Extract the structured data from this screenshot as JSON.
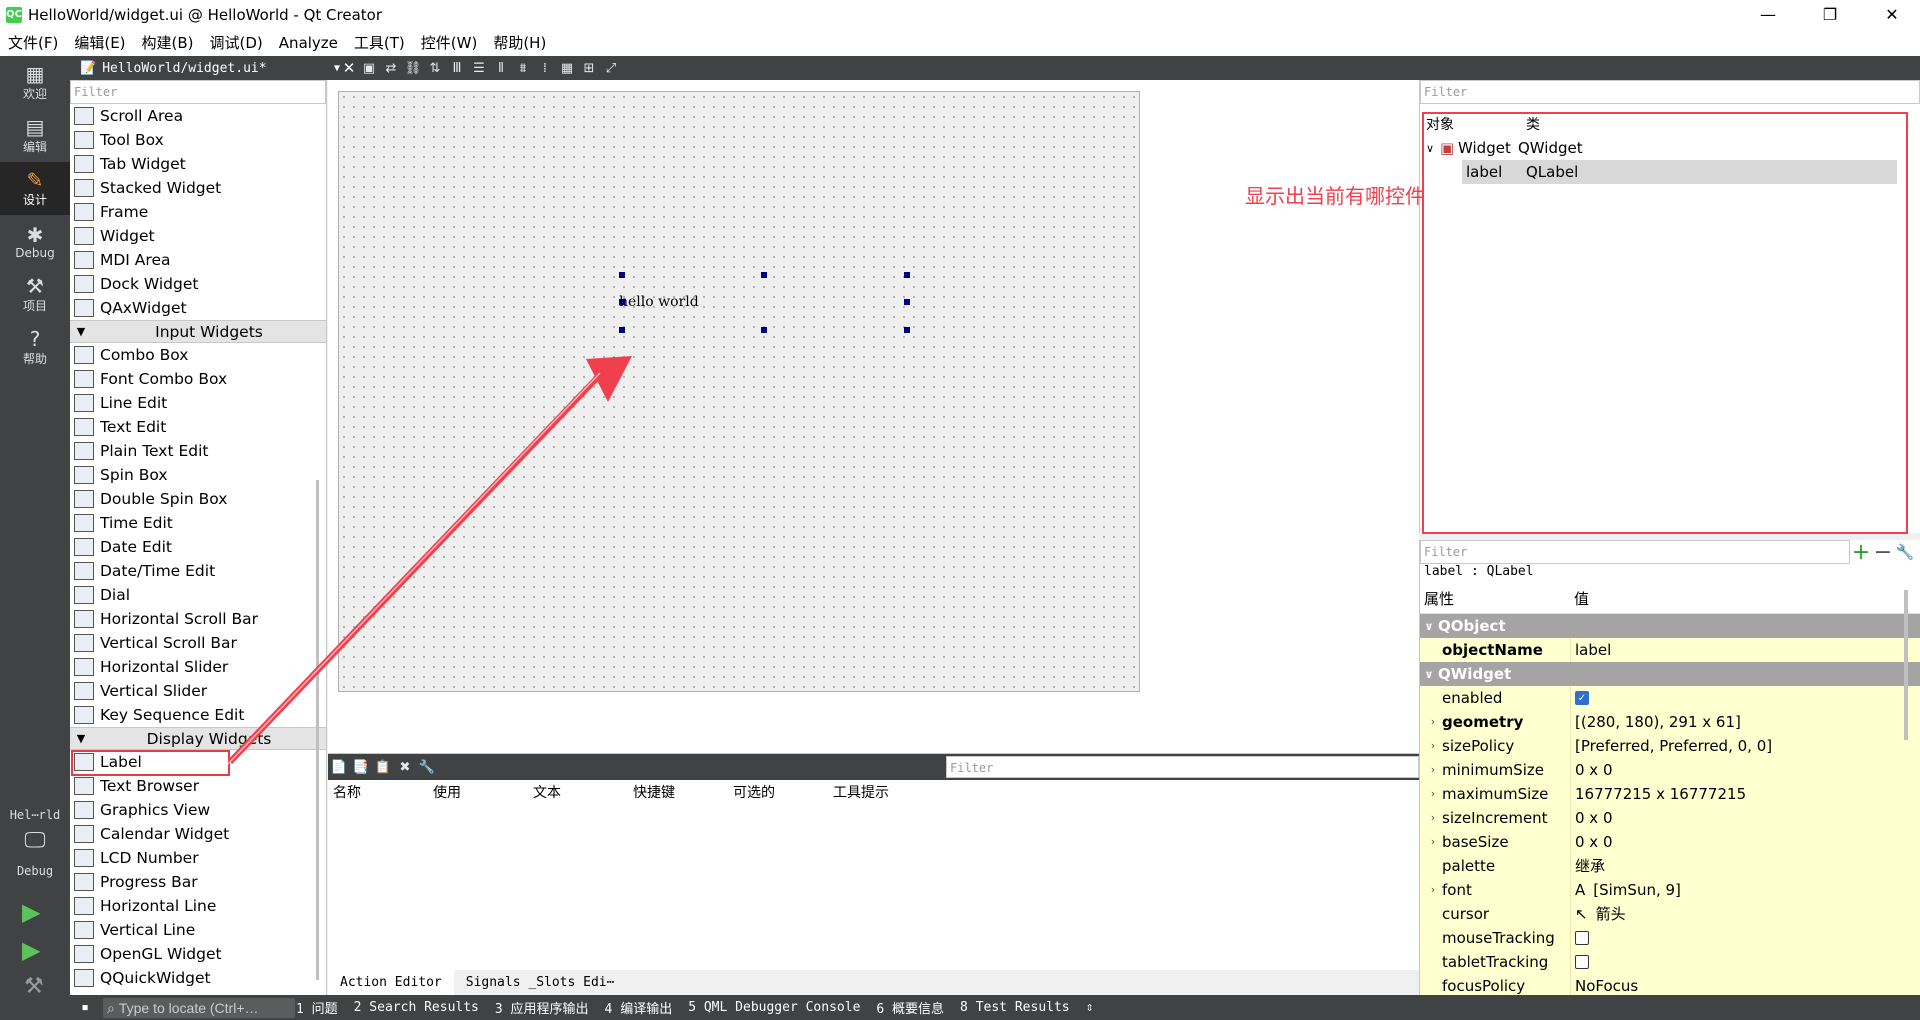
{
  "window": {
    "title": "HelloWorld/widget.ui @ HelloWorld - Qt Creator",
    "logo": "QC"
  },
  "menubar": [
    "文件(F)",
    "编辑(E)",
    "构建(B)",
    "调试(D)",
    "Analyze",
    "工具(T)",
    "控件(W)",
    "帮助(H)"
  ],
  "modes": [
    {
      "label": "欢迎",
      "icon": "grid-icon"
    },
    {
      "label": "编辑",
      "icon": "edit-icon"
    },
    {
      "label": "设计",
      "icon": "pencil-icon"
    },
    {
      "label": "Debug",
      "icon": "bug-icon"
    },
    {
      "label": "项目",
      "icon": "wrench-icon"
    },
    {
      "label": "帮助",
      "icon": "help-icon"
    }
  ],
  "kit": {
    "project": "Hel⋯rld",
    "config": "Debug"
  },
  "editor_tab": {
    "file": "HelloWorld/widget.ui*"
  },
  "widgetbox": {
    "filter_placeholder": "Filter",
    "containers": [
      "Scroll Area",
      "Tool Box",
      "Tab Widget",
      "Stacked Widget",
      "Frame",
      "Widget",
      "MDI Area",
      "Dock Widget",
      "QAxWidget"
    ],
    "input_title": "Input Widgets",
    "input": [
      "Combo Box",
      "Font Combo Box",
      "Line Edit",
      "Text Edit",
      "Plain Text Edit",
      "Spin Box",
      "Double Spin Box",
      "Time Edit",
      "Date Edit",
      "Date/Time Edit",
      "Dial",
      "Horizontal Scroll Bar",
      "Vertical Scroll Bar",
      "Horizontal Slider",
      "Vertical Slider",
      "Key Sequence Edit"
    ],
    "display_title": "Display Widgets",
    "display": [
      "Label",
      "Text Browser",
      "Graphics View",
      "Calendar Widget",
      "LCD Number",
      "Progress Bar",
      "Horizontal Line",
      "Vertical Line",
      "OpenGL Widget",
      "QQuickWidget"
    ]
  },
  "form": {
    "label_text": "hello world"
  },
  "action_editor": {
    "filter_placeholder": "Filter",
    "columns": [
      "名称",
      "使用",
      "文本",
      "快捷键",
      "可选的",
      "工具提示"
    ],
    "tabs": [
      "Action Editor",
      "Signals _Slots Edi⋯"
    ]
  },
  "object_inspector": {
    "filter_placeholder": "Filter",
    "col_object": "对象",
    "col_class": "类",
    "rows": [
      {
        "object": "Widget",
        "class": "QWidget"
      },
      {
        "object": "label",
        "class": "QLabel"
      }
    ],
    "annotation": "显示出当前有哪控件"
  },
  "property_editor": {
    "filter_placeholder": "Filter",
    "class_line": "label : QLabel",
    "col_property": "属性",
    "col_value": "值",
    "section_qobject": "QObject",
    "objectName": {
      "name": "objectName",
      "value": "label"
    },
    "section_qwidget": "QWidget",
    "rows": [
      {
        "name": "enabled",
        "value": "",
        "expand": false,
        "bold": false,
        "check": "on"
      },
      {
        "name": "geometry",
        "value": "[(280, 180), 291 x 61]",
        "expand": true,
        "bold": true
      },
      {
        "name": "sizePolicy",
        "value": "[Preferred, Preferred, 0, 0]",
        "expand": true,
        "bold": false
      },
      {
        "name": "minimumSize",
        "value": "0 x 0",
        "expand": true,
        "bold": false
      },
      {
        "name": "maximumSize",
        "value": "16777215 x 16777215",
        "expand": true,
        "bold": false
      },
      {
        "name": "sizeIncrement",
        "value": "0 x 0",
        "expand": true,
        "bold": false
      },
      {
        "name": "baseSize",
        "value": "0 x 0",
        "expand": true,
        "bold": false
      },
      {
        "name": "palette",
        "value": "继承",
        "expand": false,
        "bold": false
      },
      {
        "name": "font",
        "value": "[SimSun, 9]",
        "expand": true,
        "bold": false,
        "prefix": "A"
      },
      {
        "name": "cursor",
        "value": "箭头",
        "expand": false,
        "bold": false,
        "prefix": "↖"
      },
      {
        "name": "mouseTracking",
        "value": "",
        "expand": false,
        "bold": false,
        "check": "off"
      },
      {
        "name": "tabletTracking",
        "value": "",
        "expand": false,
        "bold": false,
        "check": "off"
      },
      {
        "name": "focusPolicy",
        "value": "NoFocus",
        "expand": false,
        "bold": false
      }
    ]
  },
  "statusbar": {
    "locate_placeholder": "Type to locate (Ctrl+…",
    "panes": [
      "1 问题",
      "2 Search Results",
      "3 应用程序输出",
      "4 编译输出",
      "5 QML Debugger Console",
      "6 概要信息",
      "8 Test Results"
    ]
  },
  "colors": {
    "annotation": "#f0404e",
    "sidebar": "#404244",
    "property_row": "#ffffcf"
  }
}
